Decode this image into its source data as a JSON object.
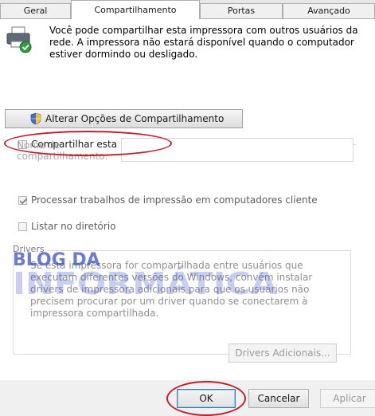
{
  "tabs": [
    {
      "label": "Geral"
    },
    {
      "label": "Compartilhamento"
    },
    {
      "label": "Portas"
    },
    {
      "label": "Avançado"
    }
  ],
  "intro_text": "Você pode compartilhar esta impressora com outros usuários da rede. A impressora não estará disponível quando o computador estiver dormindo ou desligado.",
  "share_options_button": "Alterar Opções de Compartilhamento",
  "share_printer_checkbox": {
    "label": "Compartilhar esta impressora",
    "checked": false
  },
  "share_name": {
    "label": "Nome de compartilhamento:",
    "value": ""
  },
  "render_jobs_checkbox": {
    "label": "Processar trabalhos de impressão em computadores cliente",
    "checked": true
  },
  "list_directory_checkbox": {
    "label": "Listar no diretório",
    "checked": false
  },
  "drivers": {
    "title": "Drivers",
    "text": "Se esta impressora for compartilhada entre usuários que executam diferentes versões do Windows, convém instalar drivers de impressora adicionais para que os usuários não precisem procurar por um driver quando se conectarem à impressora compartilhada.",
    "additional_button": "Drivers Adicionais..."
  },
  "footer": {
    "ok": "OK",
    "cancel": "Cancelar",
    "apply": "Aplicar"
  },
  "watermark": {
    "line1": "BLOG DA",
    "line2": "INFORMÁTICA"
  },
  "colors": {
    "annotation_red": "#c0202a",
    "watermark_blue": "#3a4fc4"
  }
}
